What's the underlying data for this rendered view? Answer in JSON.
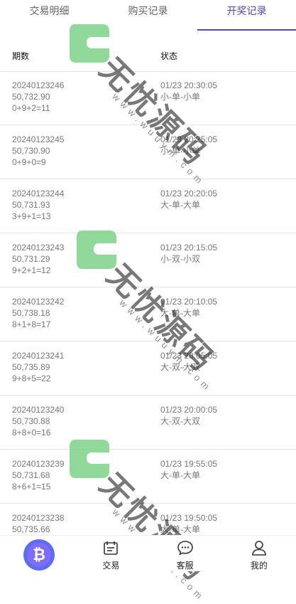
{
  "tabs": [
    {
      "label": "交易明细",
      "active": false
    },
    {
      "label": "购买记录",
      "active": false
    },
    {
      "label": "开奖记录",
      "active": true
    }
  ],
  "table": {
    "headers": [
      "期数",
      "状态"
    ],
    "rows": [
      {
        "period": "20240123246",
        "price": "50,732.90",
        "formula": "0+9+2=11",
        "time": "01/23 20:30:05",
        "result": "小-单-小单"
      },
      {
        "period": "20240123245",
        "price": "50,730.90",
        "formula": "0+9+0=9",
        "time": "01/23 20:25:05",
        "result": "小-单-小单"
      },
      {
        "period": "20240123244",
        "price": "50,731.93",
        "formula": "3+9+1=13",
        "time": "01/23 20:20:05",
        "result": "大-单-大单"
      },
      {
        "period": "20240123243",
        "price": "50,731.29",
        "formula": "9+2+1=12",
        "time": "01/23 20:15:05",
        "result": "小-双-小双"
      },
      {
        "period": "20240123242",
        "price": "50,738.18",
        "formula": "8+1+8=17",
        "time": "01/23 20:10:05",
        "result": "大-单-大单"
      },
      {
        "period": "20240123241",
        "price": "50,735.89",
        "formula": "9+8+5=22",
        "time": "01/23 20:05:05",
        "result": "大-双-大双"
      },
      {
        "period": "20240123240",
        "price": "50,730.88",
        "formula": "8+8+0=16",
        "time": "01/23 20:00:05",
        "result": "大-双-大双"
      },
      {
        "period": "20240123239",
        "price": "50,731.68",
        "formula": "8+6+1=15",
        "time": "01/23 19:55:05",
        "result": "大-单-大单"
      },
      {
        "period": "20240123238",
        "price": "50,735.66",
        "formula": "",
        "time": "01/23 19:50:05",
        "result": "大-单-大单"
      }
    ]
  },
  "watermark": {
    "text": "无忧源码",
    "url": "www.wuuym.com"
  },
  "nav": {
    "items": [
      {
        "label": "",
        "icon": "bitcoin-icon"
      },
      {
        "label": "交易",
        "icon": "calendar-icon"
      },
      {
        "label": "客服",
        "icon": "chat-icon"
      },
      {
        "label": "我的",
        "icon": "user-icon"
      }
    ]
  },
  "colors": {
    "accent": "#5b3fd6",
    "watermark_green": "#7ed389",
    "bitcoin": "#5b6cf5"
  }
}
